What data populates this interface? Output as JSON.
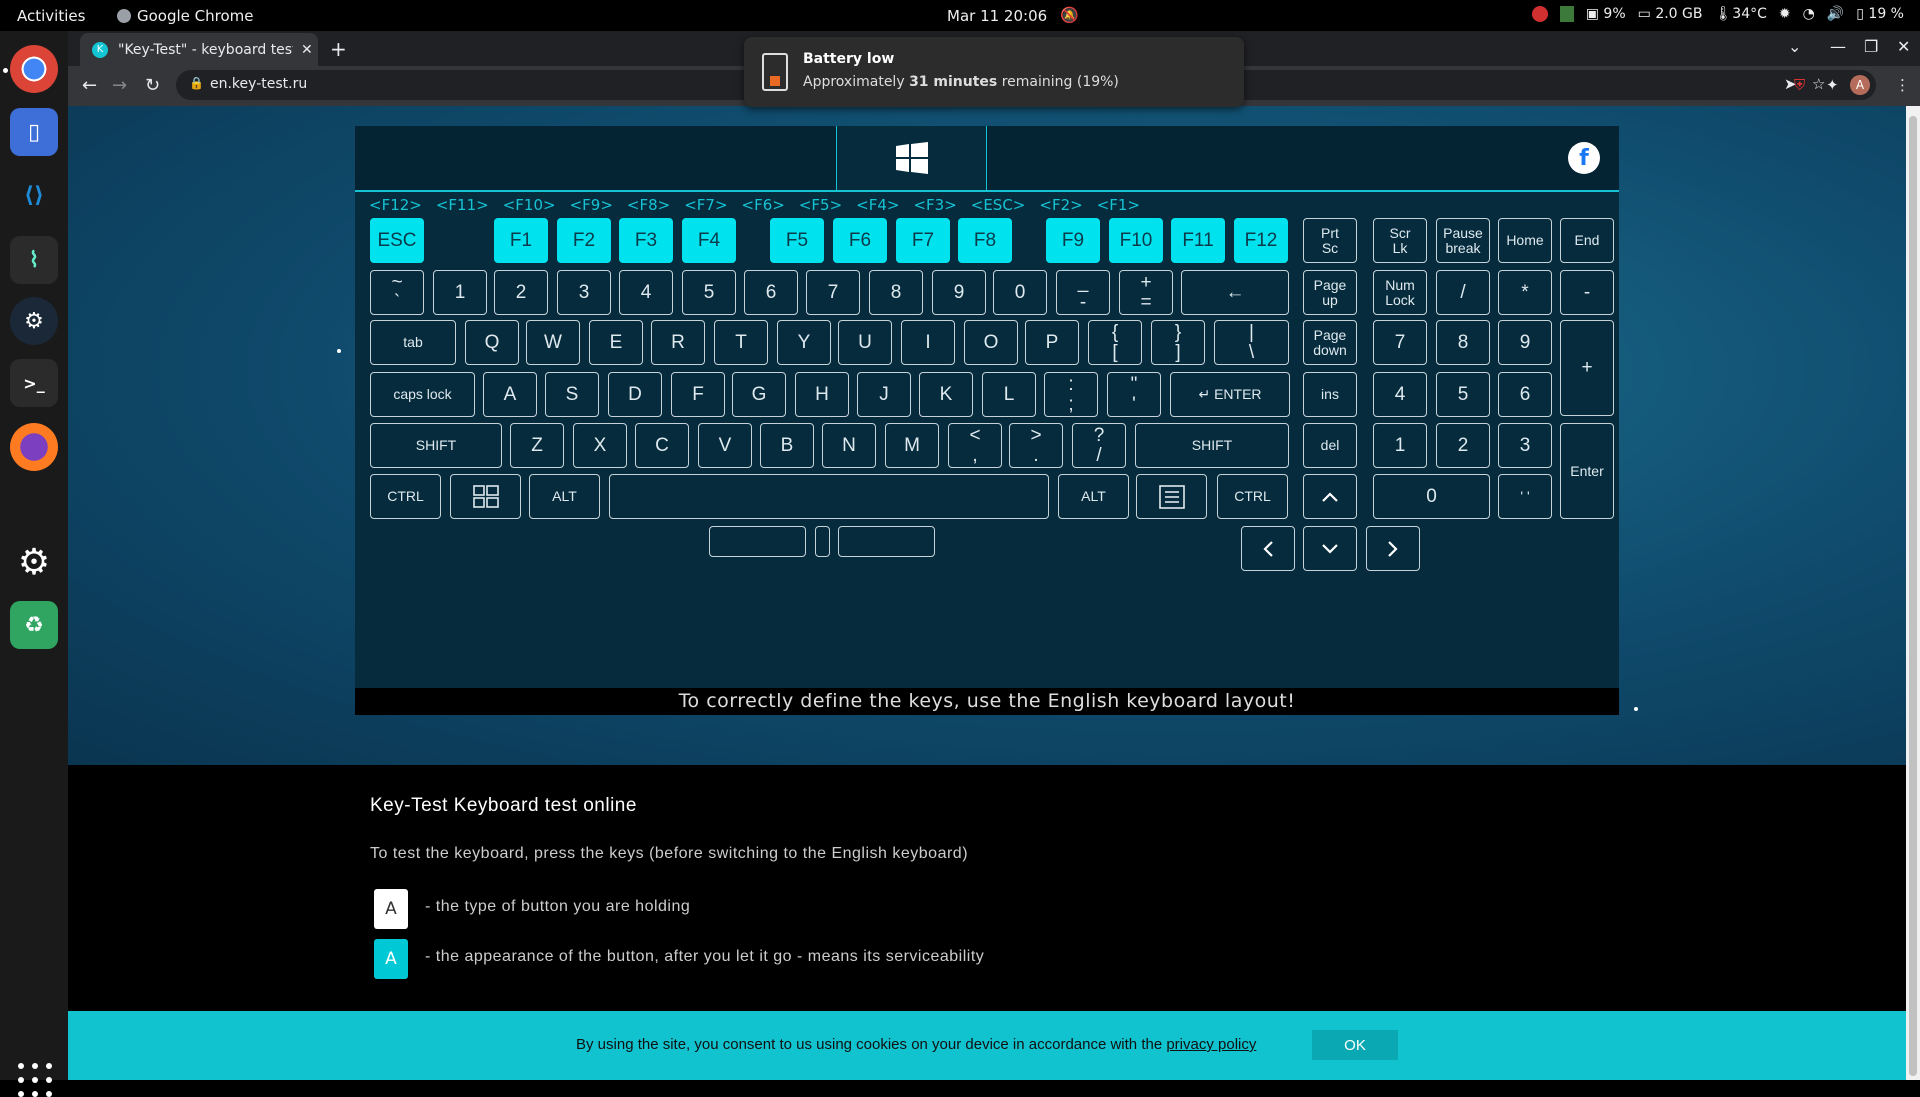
{
  "topbar": {
    "activities": "Activities",
    "app_name": "Google Chrome",
    "datetime": "Mar 11  20:06",
    "tray": {
      "disk": "9%",
      "memory": "2.0 GB",
      "temp": "34°C",
      "battery": "19 %"
    }
  },
  "notification": {
    "title": "Battery low",
    "message_prefix": "Approximately ",
    "message_bold": "31 minutes",
    "message_suffix": " remaining (19%)"
  },
  "browser": {
    "tab_title": "\"Key-Test\" - keyboard test",
    "url": "en.key-test.ru"
  },
  "keyboard": {
    "history": [
      "<F12>",
      "<F11>",
      "<F10>",
      "<F9>",
      "<F8>",
      "<F7>",
      "<F6>",
      "<F5>",
      "<F4>",
      "<F3>",
      "<ESC>",
      "<F2>",
      "<F1>"
    ],
    "notice": "To correctly define the keys, use the English keyboard layout!"
  },
  "info": {
    "heading": "Key-Test Keyboard test online",
    "instruction": "To test the keyboard, press the keys (before switching to the English keyboard)",
    "legend_key": "A",
    "legend_holding": "- the type of button you are holding",
    "legend_released": "- the appearance of the button, after you let it go - means its serviceability"
  },
  "cookie": {
    "text": "By using the site, you consent to us using cookies on your device in accordance with the ",
    "link": "privacy policy",
    "ok": "OK"
  },
  "colors": {
    "accent": "#00e3ef",
    "panel": "#052b3d",
    "cookie_bar": "#11c3cf"
  }
}
